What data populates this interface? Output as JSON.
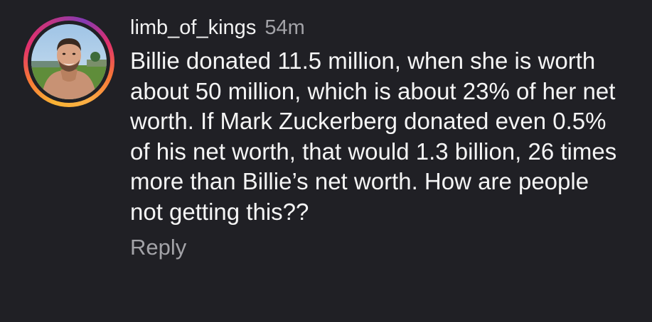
{
  "comment": {
    "username": "limb_of_kings",
    "timestamp": "54m",
    "text": "Billie donated 11.5 million, when she is worth about 50 million, which is about 23% of her net worth. If Mark Zuckerberg donated even 0.5% of his net worth, that would 1.3 billion, 26 times more than Billie’s net worth. How are people not getting this??",
    "reply_label": "Reply",
    "has_story_ring": true
  },
  "colors": {
    "background": "#202025",
    "primary_text": "#f5f5f5",
    "secondary_text": "#a3a3a8",
    "story_ring": [
      "#fcaf45",
      "#f77737",
      "#e1306c",
      "#c13584",
      "#833ab4"
    ]
  }
}
